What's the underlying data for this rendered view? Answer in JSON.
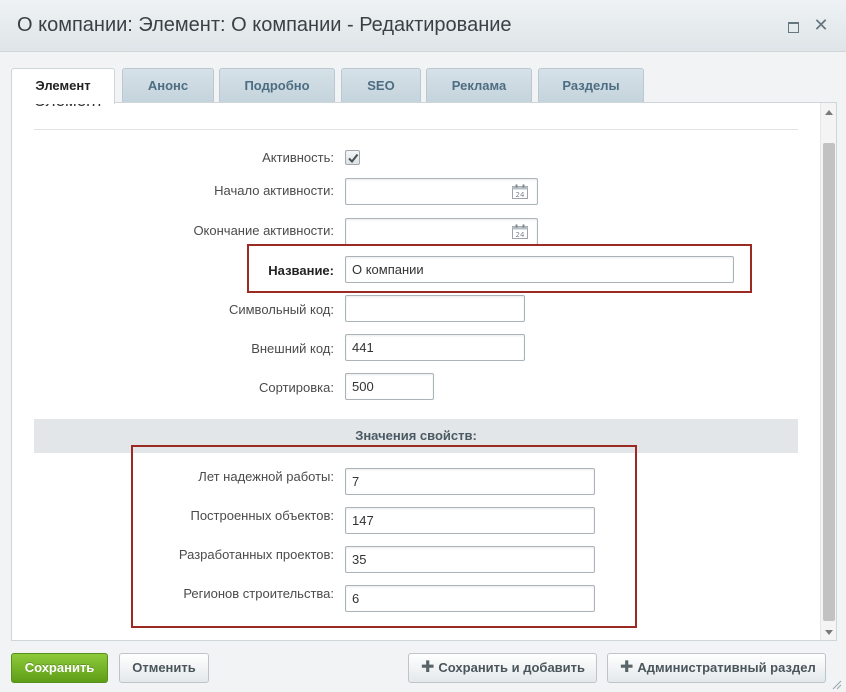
{
  "window": {
    "title": "О компании: Элемент: О компании - Редактирование",
    "maximize_icon": "maximize-icon",
    "close_icon": "close-icon",
    "close_glyph": "✕"
  },
  "tabs": [
    {
      "label": "Элемент",
      "active": true
    },
    {
      "label": "Анонс",
      "active": false
    },
    {
      "label": "Подробно",
      "active": false
    },
    {
      "label": "SEO",
      "active": false
    },
    {
      "label": "Реклама",
      "active": false
    },
    {
      "label": "Разделы",
      "active": false
    }
  ],
  "section": {
    "heading": "Элемент",
    "fields": {
      "active": {
        "label": "Активность:",
        "checked": true
      },
      "active_from": {
        "label": "Начало активности:",
        "value": "",
        "icon": "calendar-icon",
        "icon_day": "24"
      },
      "active_to": {
        "label": "Окончание активности:",
        "value": "",
        "icon": "calendar-icon",
        "icon_day": "24"
      },
      "name": {
        "label": "Название:",
        "value": "О компании"
      },
      "code": {
        "label": "Символьный код:",
        "value": ""
      },
      "xml_id": {
        "label": "Внешний код:",
        "value": "441"
      },
      "sort": {
        "label": "Сортировка:",
        "value": "500"
      }
    }
  },
  "properties": {
    "heading": "Значения свойств:",
    "items": [
      {
        "label": "Лет надежной работы:",
        "value": "7"
      },
      {
        "label": "Построенных объектов:",
        "value": "147"
      },
      {
        "label": "Разработанных проектов:",
        "value": "35"
      },
      {
        "label": "Регионов строительства:",
        "value": "6"
      }
    ]
  },
  "footer": {
    "save": "Сохранить",
    "cancel": "Отменить",
    "save_add": "Сохранить и добавить",
    "admin_section": "Административный раздел",
    "plus_icon": "plus-icon",
    "plus_glyph": "✚"
  },
  "colors": {
    "highlight": "#9b2a22",
    "primary_button": "#6fae22",
    "tab_text": "#4d6d82"
  }
}
